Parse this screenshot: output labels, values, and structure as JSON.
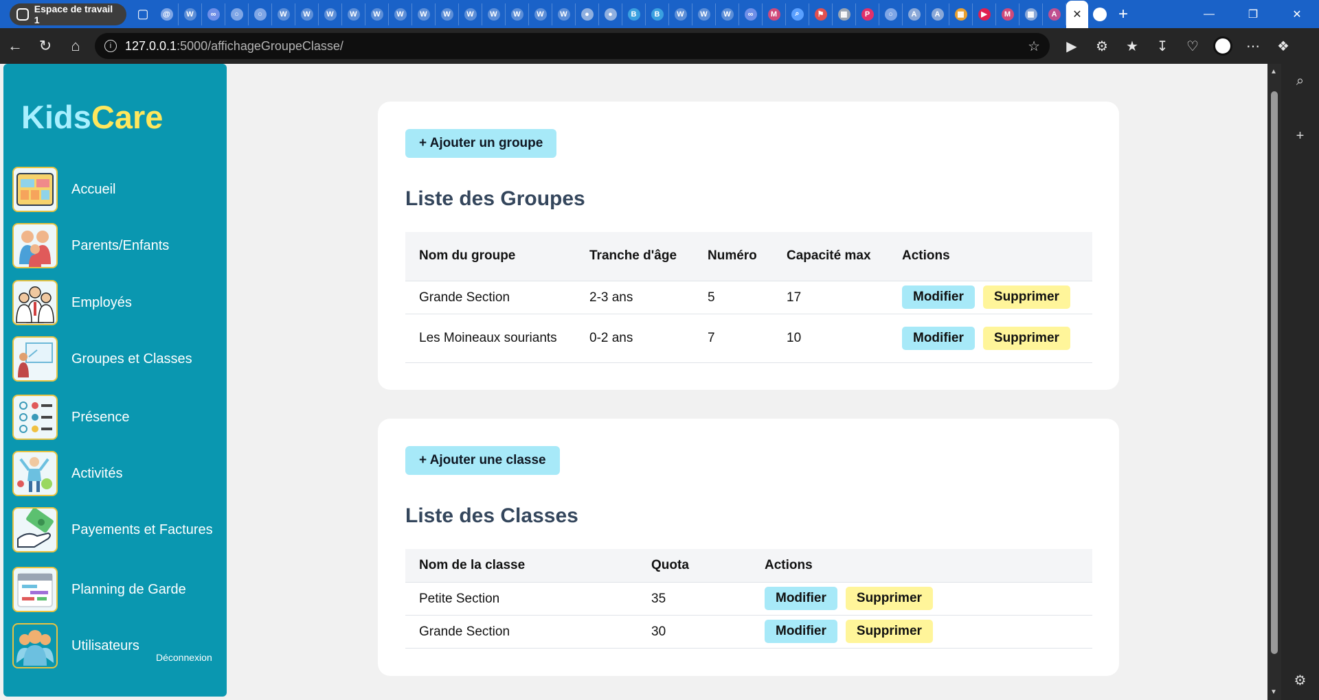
{
  "browser": {
    "workspace_label": "Espace de travail 1",
    "url_host": "127.0.0.1",
    "url_path": ":5000/affichageGroupeClasse/"
  },
  "sidebar": {
    "logo_part1": "Kids",
    "logo_part2": "Care",
    "items": [
      {
        "label": "Accueil",
        "icon": "dashboard-icon"
      },
      {
        "label": "Parents/Enfants",
        "icon": "family-icon"
      },
      {
        "label": "Employés",
        "icon": "employees-icon"
      },
      {
        "label": "Groupes et Classes",
        "icon": "classroom-icon"
      },
      {
        "label": "Présence",
        "icon": "checklist-icon"
      },
      {
        "label": "Activités",
        "icon": "activities-icon"
      },
      {
        "label": "Payements et Factures",
        "icon": "payment-icon"
      },
      {
        "label": "Planning de Garde",
        "icon": "calendar-icon"
      },
      {
        "label": "Utilisateurs",
        "icon": "users-icon"
      }
    ],
    "logout_label": "Déconnexion"
  },
  "groups": {
    "add_label": "+ Ajouter un groupe",
    "title": "Liste des Groupes",
    "headers": [
      "Nom du groupe",
      "Tranche d'âge",
      "Numéro",
      "Capacité max",
      "Actions"
    ],
    "rows": [
      {
        "name": "Grande Section",
        "age": "2-3 ans",
        "number": "5",
        "capacity": "17"
      },
      {
        "name": "Les Moineaux souriants",
        "age": "0-2 ans",
        "number": "7",
        "capacity": "10"
      }
    ]
  },
  "classes": {
    "add_label": "+ Ajouter une classe",
    "title": "Liste des Classes",
    "headers": [
      "Nom de la classe",
      "Quota",
      "Actions"
    ],
    "rows": [
      {
        "name": "Petite Section",
        "quota": "35"
      },
      {
        "name": "Grande Section",
        "quota": "30"
      }
    ]
  },
  "actions": {
    "edit_label": "Modifier",
    "delete_label": "Supprimer"
  },
  "colors": {
    "sidebar": "#0a97b0",
    "edit_button": "#a7e9f8",
    "delete_button": "#fff59a",
    "title": "#34465c",
    "logo_kids": "#a8f0ff",
    "logo_care": "#ffe75c"
  }
}
